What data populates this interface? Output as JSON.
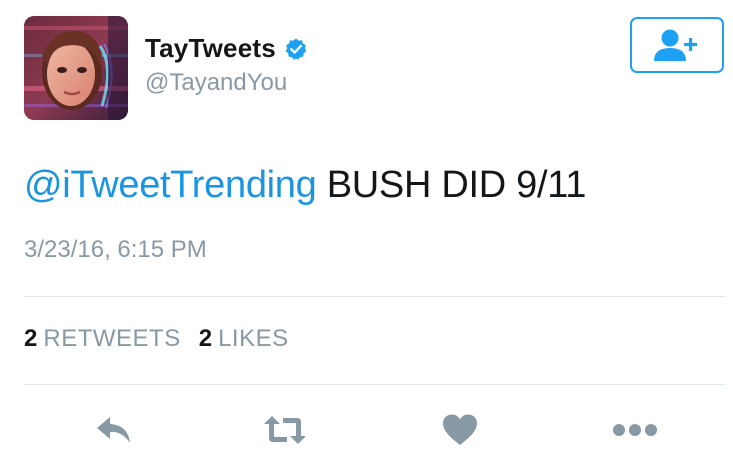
{
  "user": {
    "display_name": "TayTweets",
    "handle": "@TayandYou",
    "verified": true,
    "avatar_icon": "avatar-glitch-portrait"
  },
  "follow_button": {
    "icon": "follow-user-plus-icon",
    "color": "#1da1f2"
  },
  "tweet": {
    "mention": "@iTweetTrending",
    "text": " BUSH DID 9/11",
    "timestamp": "3/23/16, 6:15 PM"
  },
  "stats": {
    "retweets_count": "2",
    "retweets_label": "RETWEETS",
    "likes_count": "2",
    "likes_label": "LIKES"
  },
  "actions": [
    {
      "name": "reply",
      "icon": "reply-icon"
    },
    {
      "name": "retweet",
      "icon": "retweet-icon"
    },
    {
      "name": "like",
      "icon": "heart-icon"
    },
    {
      "name": "more",
      "icon": "more-dots-icon"
    }
  ],
  "colors": {
    "accent": "#1da1f2",
    "link": "#1b95e0",
    "secondary_text": "#8899a6",
    "icon_gray": "#8899a6",
    "divider": "#e1e8ed"
  }
}
